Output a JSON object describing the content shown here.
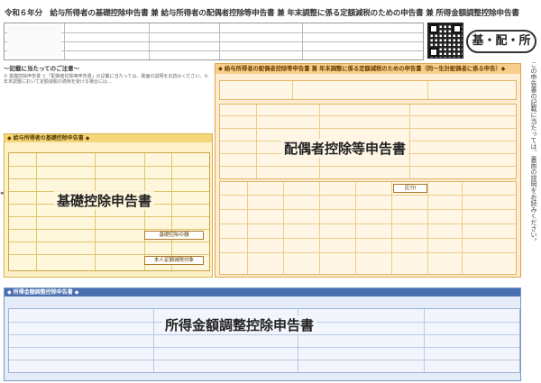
{
  "header": {
    "title": "令和６年分　給与所得者の基礎控除申告書 兼 給与所得者の配偶者控除等申告書 兼 年末調整に係る定額減税のための申告書 兼 所得金額調整控除申告書",
    "badge": "基・配・所"
  },
  "notes": {
    "heading": "～記載に当たってのご注意～",
    "text": "① 基礎控除申告書 と「配偶者控除等申告書」の記載に当たっては、裏面の説明をお読みください。② 年末調整において定額減税の適用を受ける場合には…"
  },
  "sections": {
    "basic_label": "基礎控除申告書",
    "spouse_label": "配偶者控除等申告書",
    "income_label": "所得金額調整控除申告書",
    "basic_bar": "◆ 給与所得者の基礎控除申告書 ◆",
    "spouse_bar": "◆ 給与所得者の配偶者控除等申告書 兼 年末調整に係る定額減税のための申告書（同一生計配偶者に係る申告）◆",
    "income_bar": "◆ 所得金額調整控除申告書 ◆"
  },
  "side_note": "この申告書の記載に当たっては、裏面の説明をお読みください。",
  "buttons": {
    "basic_amount": "基礎控除の額",
    "spouse_calc": "区分Ⅰ",
    "self_check": "本人定額減税対象"
  },
  "colors": {
    "basic": "#fdf1c9",
    "spouse": "#fdeed3",
    "income": "#e4ecf7"
  }
}
